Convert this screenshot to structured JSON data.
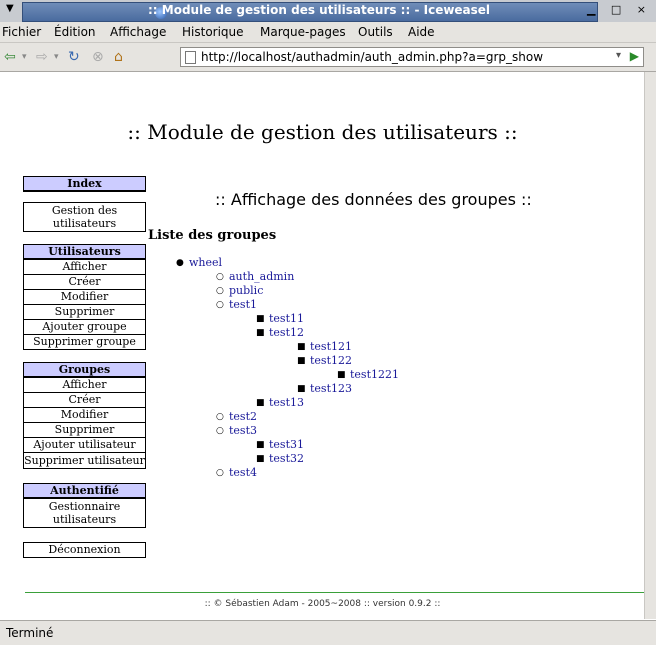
{
  "window": {
    "title": ":: Module de gestion des utilisateurs :: - Iceweasel",
    "controls": "▁ □ ×"
  },
  "menubar": {
    "items": [
      "Fichier",
      "Édition",
      "Affichage",
      "Historique",
      "Marque-pages",
      "Outils",
      "Aide"
    ]
  },
  "navbar": {
    "url": "http://localhost/authadmin/auth_admin.php?a=grp_show"
  },
  "page": {
    "h1": ":: Module de gestion des utilisateurs ::",
    "subtitle": ":: Affichage des données des groupes ::",
    "list_heading": "Liste des groupes",
    "footer": ":: © Sébastien Adam - 2005~2008 :: version 0.9.2 ::"
  },
  "sidebar": {
    "index": {
      "title": "Index",
      "items": [
        "Gestion des utilisateurs"
      ]
    },
    "users": {
      "title": "Utilisateurs",
      "items": [
        "Afficher",
        "Créer",
        "Modifier",
        "Supprimer",
        "Ajouter groupe",
        "Supprimer groupe"
      ]
    },
    "groups": {
      "title": "Groupes",
      "items": [
        "Afficher",
        "Créer",
        "Modifier",
        "Supprimer",
        "Ajouter utilisateur",
        "Supprimer utilisateur"
      ]
    },
    "auth": {
      "title": "Authentifié",
      "items": [
        "Gestionnaire utilisateurs"
      ]
    },
    "logout": {
      "label": "Déconnexion"
    }
  },
  "tree": {
    "root": "wheel",
    "level1": [
      "auth_admin",
      "public",
      "test1"
    ],
    "test1_children": [
      "test11",
      "test12"
    ],
    "test12_children": [
      "test121",
      "test122"
    ],
    "test122_children": [
      "test1221"
    ],
    "test12_more": [
      "test123"
    ],
    "test1_more": [
      "test13"
    ],
    "level1_more": [
      "test2",
      "test3"
    ],
    "test3_children": [
      "test31",
      "test32"
    ],
    "level1_last": [
      "test4"
    ]
  },
  "status": {
    "text": "Terminé"
  },
  "colors": {
    "menu_header_bg": "#ccccff",
    "link": "#1a1a99",
    "footer_line": "#3aa03a"
  }
}
